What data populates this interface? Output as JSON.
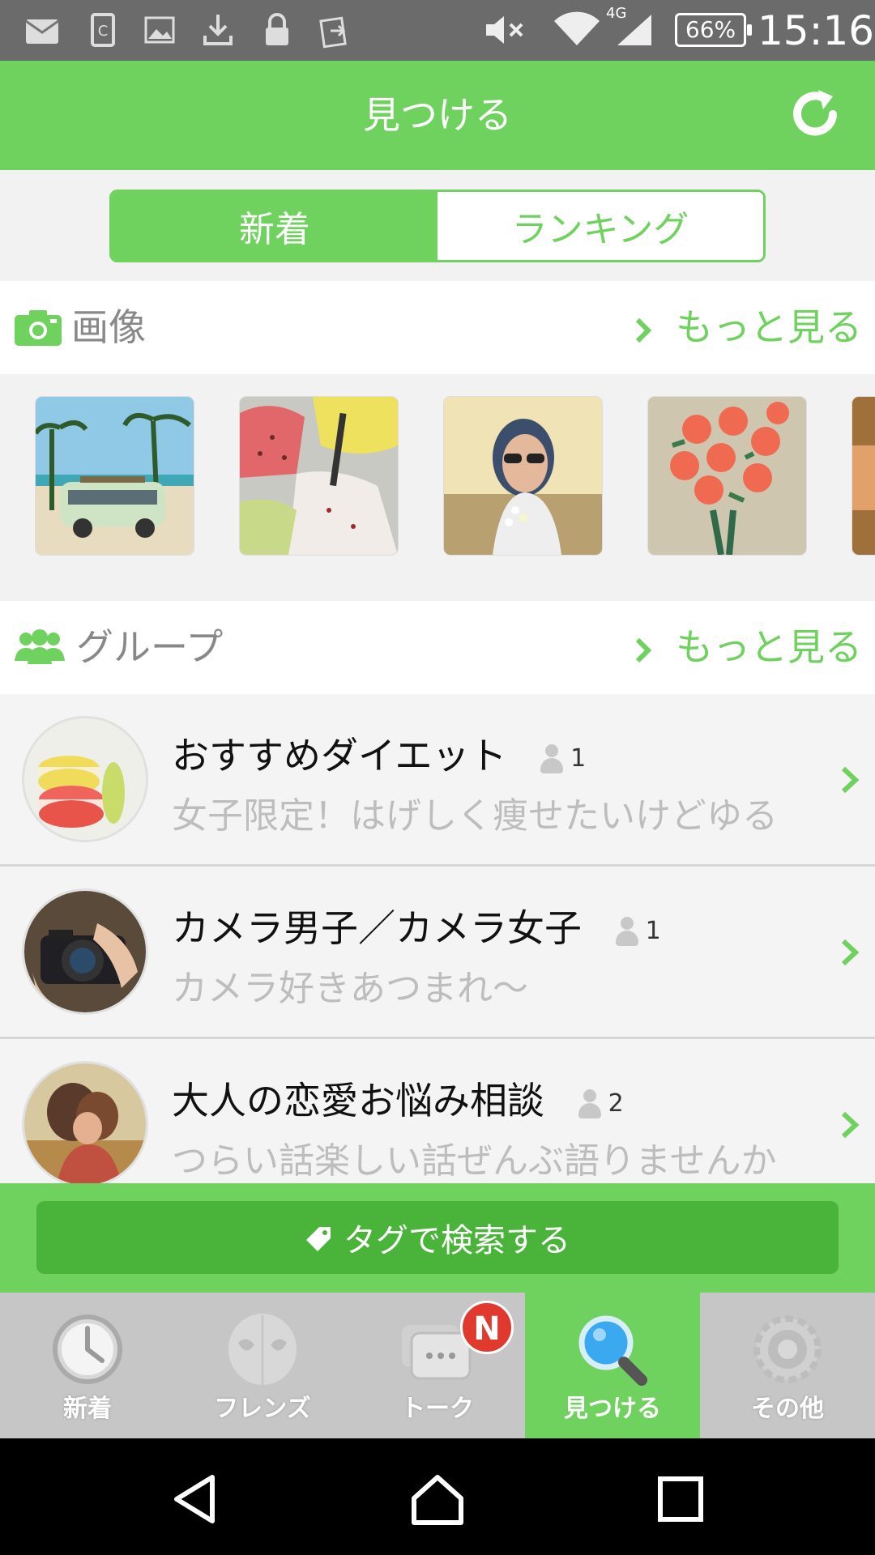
{
  "status_bar": {
    "network": "4G",
    "battery": "66%",
    "time": "15:16",
    "icons": [
      "au-mail-icon",
      "sim-icon",
      "image-icon",
      "download-icon",
      "lock-icon",
      "transfer-icon",
      "mute-icon",
      "wifi-icon",
      "signal-icon"
    ]
  },
  "app_bar": {
    "title": "見つける",
    "refresh_icon": "refresh-icon"
  },
  "segments": {
    "new": "新着",
    "ranking": "ランキング",
    "selected": "新着"
  },
  "images_section": {
    "title": "画像",
    "more": "もっと見る",
    "thumbnails": [
      "beach-van",
      "ice-cream",
      "woman-sunglasses",
      "roses",
      "partial-image"
    ]
  },
  "groups_section": {
    "title": "グループ",
    "more": "もっと見る",
    "items": [
      {
        "title": "おすすめダイエット",
        "members": "1",
        "description": "女子限定！はげしく痩せたいけどゆる"
      },
      {
        "title": "カメラ男子／カメラ女子",
        "members": "1",
        "description": "カメラ好きあつまれ〜"
      },
      {
        "title": "大人の恋愛お悩み相談",
        "members": "2",
        "description": "つらい話楽しい話ぜんぶ語りませんか"
      }
    ]
  },
  "tag_search": {
    "label": "タグで検索する"
  },
  "bottom_nav": {
    "items": [
      {
        "label": "新着",
        "icon": "clock-icon"
      },
      {
        "label": "フレンズ",
        "icon": "friends-icon"
      },
      {
        "label": "トーク",
        "icon": "chat-icon"
      },
      {
        "label": "見つける",
        "icon": "magnifier-icon"
      },
      {
        "label": "その他",
        "icon": "gear-icon"
      }
    ],
    "active": "見つける",
    "badge": "N"
  },
  "colors": {
    "accent": "#6fd15e",
    "accent_dark": "#4ab43a",
    "badge": "#e03a2e"
  }
}
